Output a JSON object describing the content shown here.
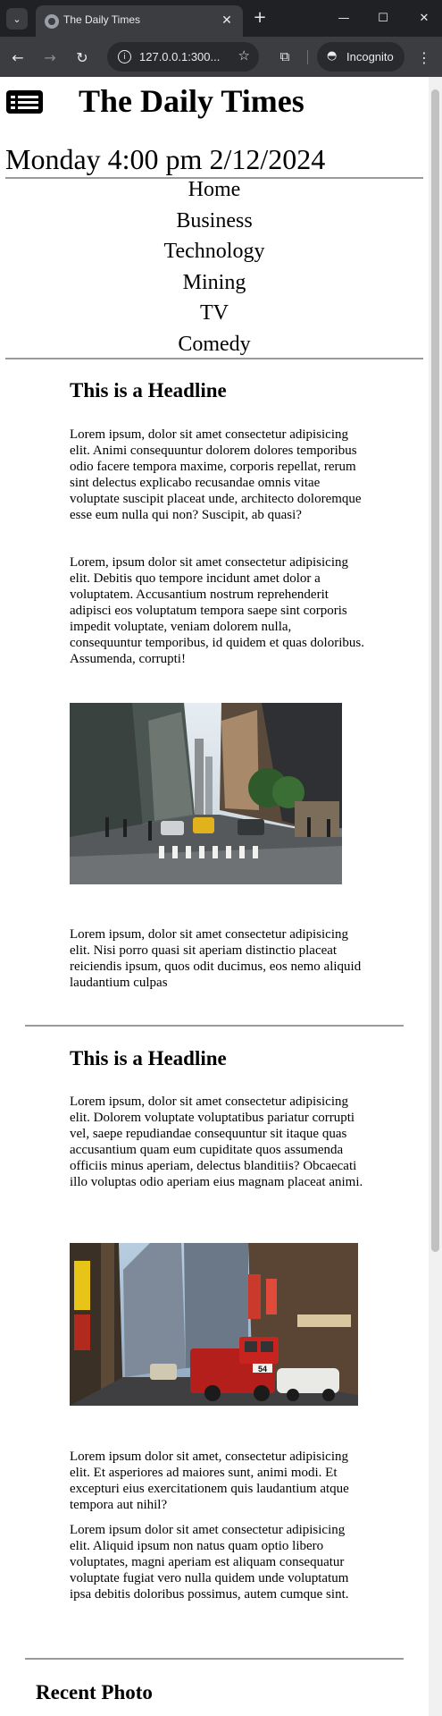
{
  "browser": {
    "tab_title": "The Daily Times",
    "tab_close": "✕",
    "new_tab": "+",
    "url": "127.0.0.1:300...",
    "incognito_label": "Incognito",
    "window_controls": {
      "minimize": "—",
      "maximize": "☐",
      "close": "✕"
    },
    "icons": {
      "tab_menu": "chevron-down-icon",
      "back": "arrow-left-icon",
      "forward": "arrow-right-icon",
      "reload": "reload-icon",
      "site_info": "info-icon",
      "bookmark": "star-icon",
      "extensions": "puzzle-icon",
      "incognito": "incognito-icon",
      "menu": "kebab-menu-icon"
    }
  },
  "site": {
    "logo_icon": "newspaper-icon",
    "title": "The Daily Times",
    "datetime": "Monday 4:00 pm 2/12/2024",
    "nav": [
      "Home",
      "Business",
      "Technology",
      "Mining",
      "TV",
      "Comedy"
    ]
  },
  "articles": [
    {
      "headline": "This is a Headline",
      "paragraphs_before_image": [
        "Lorem ipsum, dolor sit amet consectetur adipisicing elit. Animi consequuntur dolorem dolores temporibus odio facere tempora maxime, corporis repellat, rerum sint delectus explicabo recusandae omnis vitae voluptate suscipit placeat unde, architecto doloremque esse eum nulla qui non? Suscipit, ab quasi?",
        "Lorem, ipsum dolor sit amet consectetur adipisicing elit. Debitis quo tempore incidunt amet dolor a voluptatem. Accusantium nostrum reprehenderit adipisci eos voluptatum tempora saepe sint corporis impedit voluptate, veniam dolorem nulla, consequuntur temporibus, id quidem et quas doloribus. Assumenda, corrupti!"
      ],
      "image": "city-street-crosswalk-photo",
      "paragraphs_after_image": [
        "Lorem ipsum, dolor sit amet consectetur adipisicing elit. Nisi porro quasi sit aperiam distinctio placeat reiciendis ipsum, quos odit ducimus, eos nemo aliquid laudantium culpas"
      ]
    },
    {
      "headline": "This is a Headline",
      "paragraphs_before_image": [
        "Lorem ipsum, dolor sit amet consectetur adipisicing elit. Dolorem voluptate voluptatibus pariatur corrupti vel, saepe repudiandae consequuntur sit itaque quas accusantium quam eum cupiditate quos assumenda officiis minus aperiam, delectus blanditiis? Obcaecati illo voluptas odio aperiam eius magnam placeat animi."
      ],
      "image": "fire-truck-times-square-photo",
      "paragraphs_after_image": [
        "Lorem ipsum dolor sit amet, consectetur adipisicing elit. Et asperiores ad maiores sunt, animi modi. Et excepturi eius exercitationem quis laudantium atque tempora aut nihil?",
        "Lorem ipsum dolor sit amet consectetur adipisicing elit. Aliquid ipsum non natus quam optio libero voluptates, magni aperiam est aliquam consequatur voluptate fugiat vero nulla quidem unde voluptatum ipsa debitis doloribus possimus, autem cumque sint."
      ]
    }
  ],
  "recent_photo": {
    "heading": "Recent Photo"
  }
}
